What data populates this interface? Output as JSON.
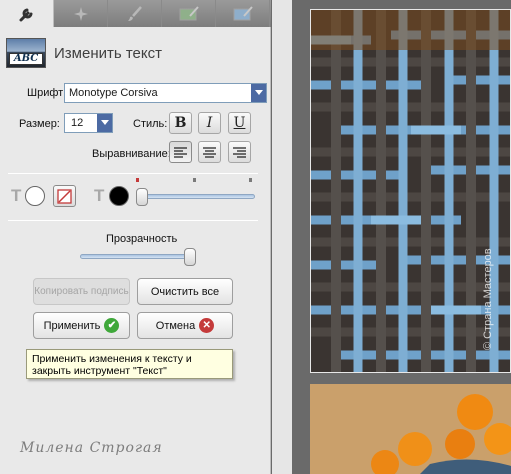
{
  "tabs": [
    {
      "name": "text-tool",
      "icon": "wrench-icon",
      "active": true
    },
    {
      "name": "effects",
      "icon": "sparkle-icon",
      "active": false
    },
    {
      "name": "brush",
      "icon": "brush-icon",
      "active": false
    },
    {
      "name": "layer-green",
      "icon": "layer-brush-icon",
      "active": false
    },
    {
      "name": "layer-blue",
      "icon": "layer-brush-icon",
      "active": false
    }
  ],
  "tool": {
    "title": "Изменить текст",
    "icon_text": "ABC"
  },
  "font": {
    "label": "Шрифт:",
    "value": "Monotype Corsiva"
  },
  "size": {
    "label": "Размер:",
    "value": "12"
  },
  "style": {
    "label": "Стиль:",
    "bold": "B",
    "italic": "I",
    "underline": "U"
  },
  "align": {
    "label": "Выравнивание:",
    "selected": "left"
  },
  "colors": {
    "text_fill": "#ffffff",
    "text_color": "#000000",
    "accent": "#4c6aa3",
    "ok_green": "#3fa83a",
    "cancel_red": "#c43a3a"
  },
  "opacity": {
    "label": "Прозрачность",
    "value_percent": 100
  },
  "outline_slider": {
    "value_percent": 0
  },
  "buttons": {
    "copy_caption": "Копировать подпись",
    "clear_all": "Очистить все",
    "apply": "Применить",
    "cancel": "Отмена"
  },
  "tooltip": "Применить изменения к тексту и закрыть инструмент \"Текст\"",
  "author": "Милена Строгая",
  "watermark": "© Страна Мастеров"
}
